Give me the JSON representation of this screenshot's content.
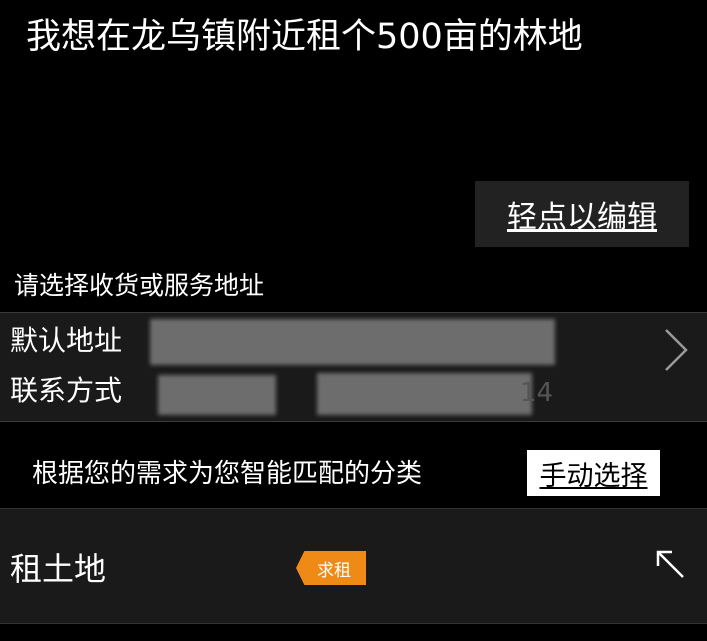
{
  "request": {
    "text": "我想在龙乌镇附近租个500亩的林地"
  },
  "edit_button": {
    "label": "轻点以编辑"
  },
  "address": {
    "section_title": "请选择收货或服务地址",
    "default_label": "默认地址",
    "contact_label": "联系方式",
    "contact_suffix": "14",
    "chevron_icon": "chevron-right-icon"
  },
  "match": {
    "text": "根据您的需求为您智能匹配的分类",
    "manual_button": "手动选择"
  },
  "category": {
    "name": "租土地",
    "tag": "求租",
    "tag_color": "#f08a17",
    "expand_icon": "arrow-up-left-icon"
  }
}
